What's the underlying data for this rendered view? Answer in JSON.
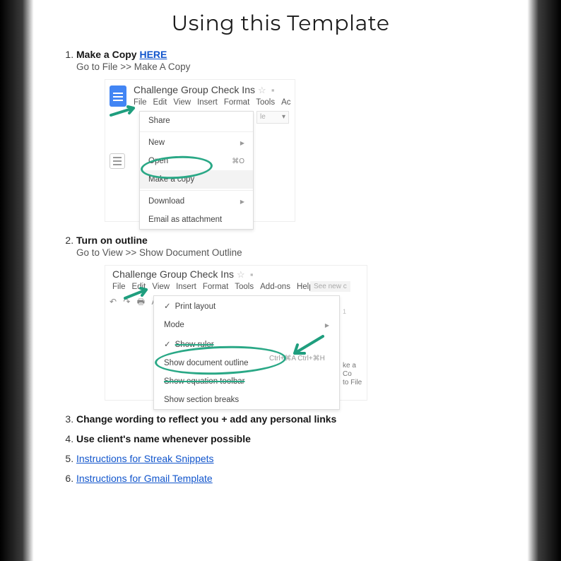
{
  "title": "Using this Template",
  "steps": [
    {
      "bold": "Make a Copy ",
      "link": "HERE",
      "sub": "Go to File >> Make A Copy"
    },
    {
      "bold": "Turn on outline",
      "sub": "Go to View >> Show Document Outline"
    },
    {
      "bold": "Change wording to reflect you + add any personal links"
    },
    {
      "bold": "Use client's name whenever possible"
    },
    {
      "link": "Instructions for Streak Snippets"
    },
    {
      "link": "Instructions for Gmail Template"
    }
  ],
  "shot1": {
    "doc_title": "Challenge Group Check Ins",
    "menu": [
      "File",
      "Edit",
      "View",
      "Insert",
      "Format",
      "Tools",
      "Ac"
    ],
    "items": {
      "share": "Share",
      "new": "New",
      "open": "Open",
      "open_kbd": "⌘O",
      "makecopy": "Make a copy",
      "download": "Download",
      "email": "Email as attachment"
    },
    "ghost": "le"
  },
  "shot2": {
    "doc_title": "Challenge Group Check Ins",
    "menu": [
      "File",
      "Edit",
      "View",
      "Insert",
      "Format",
      "Tools",
      "Add-ons",
      "Help"
    ],
    "seenew": "See new c",
    "items": {
      "print": "Print layout",
      "mode": "Mode",
      "ruler": "Show ruler",
      "outline": "Show document outline",
      "outline_kbd": "Ctrl+⌘A Ctrl+⌘H",
      "eq": "Show equation toolbar",
      "sections": "Show section breaks"
    },
    "frag1": "ke a Co",
    "frag2": "to File",
    "ruler_frag": "1"
  }
}
